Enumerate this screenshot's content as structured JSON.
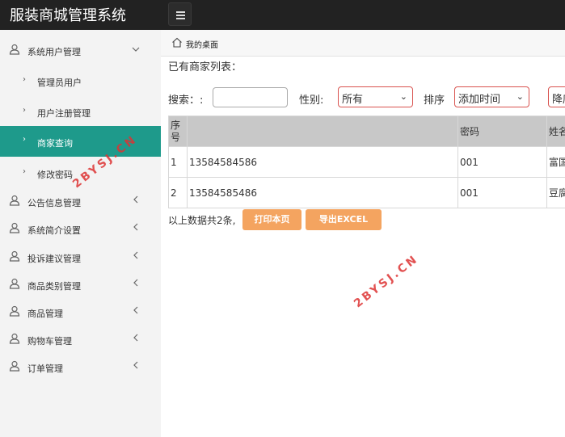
{
  "app": {
    "title": "服装商城管理系统"
  },
  "sidebar": {
    "items": [
      {
        "label": "系统用户管理",
        "expanded": true
      },
      {
        "label": "管理员用户"
      },
      {
        "label": "用户注册管理"
      },
      {
        "label": "商家查询",
        "active": true
      },
      {
        "label": "修改密码"
      },
      {
        "label": "公告信息管理"
      },
      {
        "label": "系统简介设置"
      },
      {
        "label": "投诉建议管理"
      },
      {
        "label": "商品类别管理"
      },
      {
        "label": "商品管理"
      },
      {
        "label": "购物车管理"
      },
      {
        "label": "订单管理"
      }
    ]
  },
  "breadcrumb": {
    "label": "我的桌面"
  },
  "main": {
    "list_title": "已有商家列表：",
    "search": {
      "search_label": "搜索：:",
      "search_value": "",
      "gender_label": "性别:",
      "gender_value": "所有",
      "sort_label": "排序",
      "sort_value": "添加时间",
      "order_value": "降序"
    },
    "table": {
      "headers": [
        "序号",
        "",
        "密码",
        "姓名"
      ],
      "rows": [
        [
          "1",
          "13584584586",
          "001",
          "富国"
        ],
        [
          "2",
          "13584585486",
          "001",
          "豆腐"
        ]
      ]
    },
    "footer": {
      "total_text": "以上数据共2条,",
      "print_label": "打印本页",
      "export_label": "导出EXCEL"
    }
  },
  "watermarks": [
    "2BYSJ.CN",
    "2BYSJ.CN"
  ],
  "colors": {
    "topbar": "#222222",
    "sidebar_bg": "#f3f3f3",
    "active_item": "#1e9a8b",
    "table_header": "#c8c8c8",
    "button_orange": "#f4a460",
    "select_border": "#d9534f",
    "watermark": "#dd3333"
  }
}
